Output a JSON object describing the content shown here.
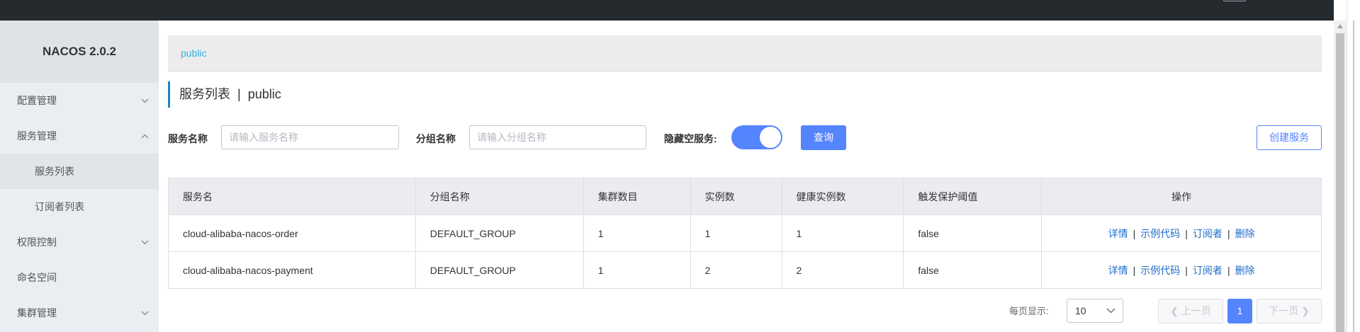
{
  "sidebar": {
    "title": "NACOS 2.0.2",
    "items": [
      {
        "label": "配置管理"
      },
      {
        "label": "服务管理"
      },
      {
        "label": "服务列表"
      },
      {
        "label": "订阅者列表"
      },
      {
        "label": "权限控制"
      },
      {
        "label": "命名空间"
      },
      {
        "label": "集群管理"
      }
    ]
  },
  "breadcrumb": {
    "namespace": "public"
  },
  "page": {
    "title": "服务列表",
    "separator": "|",
    "namespace": "public"
  },
  "filters": {
    "service_name_label": "服务名称",
    "service_name_placeholder": "请输入服务名称",
    "group_name_label": "分组名称",
    "group_name_placeholder": "请输入分组名称",
    "hide_empty_label": "隐藏空服务:",
    "hide_empty_on": true,
    "query_button": "查询",
    "create_button": "创建服务"
  },
  "table": {
    "columns": [
      "服务名",
      "分组名称",
      "集群数目",
      "实例数",
      "健康实例数",
      "触发保护阈值",
      "操作"
    ],
    "rows": [
      {
        "name": "cloud-alibaba-nacos-order",
        "group": "DEFAULT_GROUP",
        "clusters": "1",
        "instances": "1",
        "healthy": "1",
        "threshold": "false"
      },
      {
        "name": "cloud-alibaba-nacos-payment",
        "group": "DEFAULT_GROUP",
        "clusters": "1",
        "instances": "2",
        "healthy": "2",
        "threshold": "false"
      }
    ],
    "actions": {
      "detail": "详情",
      "sample": "示例代码",
      "subscriber": "订阅者",
      "delete": "删除",
      "sep": "|"
    }
  },
  "pagination": {
    "page_size_label": "每页显示:",
    "page_size": "10",
    "prev": "上一页",
    "next": "下一页",
    "current": "1"
  },
  "colors": {
    "accent": "#5584ff",
    "link": "#1e6dc8",
    "topbar": "#252a2f",
    "sidebar": "#eaedf1"
  }
}
